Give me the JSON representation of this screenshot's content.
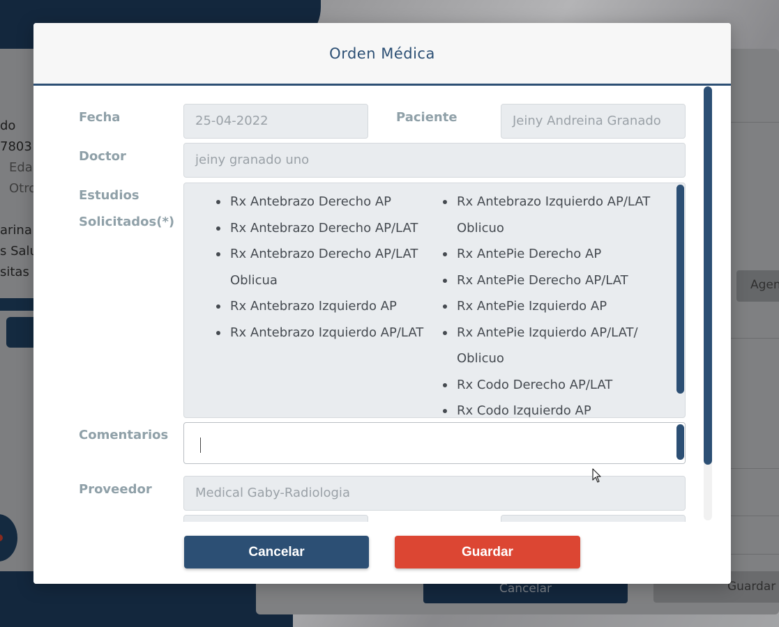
{
  "background": {
    "left_texts": [
      "do",
      "7803",
      "Eda",
      "Otro",
      "arina",
      "s Salu",
      "sitas"
    ],
    "ager_label": "Agen",
    "cancel_label": "Cancelar",
    "guardar_label": "Guardar"
  },
  "modal": {
    "title": "Orden Médica",
    "form": {
      "fecha": {
        "label": "Fecha",
        "value": "25-04-2022"
      },
      "paciente": {
        "label": "Paciente",
        "value": "Jeiny Andreina Granado"
      },
      "doctor": {
        "label": "Doctor",
        "value": "jeiny granado uno"
      },
      "estudios": {
        "label_line1": "Estudios",
        "label_line2": "Solicitados(*)",
        "items_col1": [
          "Rx Antebrazo Derecho AP",
          "Rx Antebrazo Derecho AP/LAT",
          "Rx Antebrazo Derecho AP/LAT Oblicua",
          "Rx Antebrazo Izquierdo AP",
          "Rx Antebrazo Izquierdo AP/LAT"
        ],
        "items_col2": [
          "Rx Antebrazo Izquierdo AP/LAT Oblicuo",
          "Rx AntePie Derecho AP",
          "Rx AntePie Derecho AP/LAT",
          "Rx AntePie Izquierdo AP",
          "Rx AntePie Izquierdo AP/LAT/ Oblicuo",
          "Rx Codo Derecho AP/LAT",
          "Rx Codo Izquierdo AP"
        ]
      },
      "comentarios": {
        "label": "Comentarios",
        "value": ""
      },
      "proveedor": {
        "label": "Proveedor",
        "value": "Medical Gaby-Radiologia"
      }
    },
    "buttons": {
      "cancel": "Cancelar",
      "save": "Guardar"
    }
  }
}
